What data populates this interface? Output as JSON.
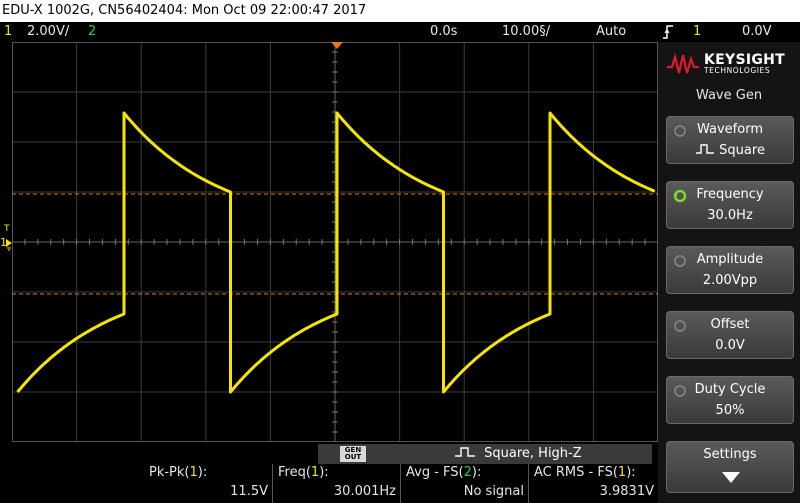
{
  "title_bar": {
    "text": "EDU-X 1002G, CN56402404: Mon Oct 09 22:00:47 2017"
  },
  "status_bar": {
    "ch1_number": "1",
    "ch1_scale": "2.00V/",
    "ch2_number": "2",
    "time_offset": "0.0s",
    "time_scale": "10.00§/",
    "trigger_mode": "Auto",
    "trigger_icon": "trigger-edge-icon",
    "trigger_source": "1",
    "trigger_level": "0.0V"
  },
  "screen": {
    "channel_marker": "1",
    "trigger_marker": "T",
    "trace_color": "#f5e600",
    "cursor_color": "#e6781e",
    "grid_color": "#3c3c3c"
  },
  "brand": {
    "name": "KEYSIGHT",
    "sub": "TECHNOLOGIES",
    "accent": "#e0182d"
  },
  "menu": {
    "title": "Wave Gen",
    "softkeys": [
      {
        "label": "Waveform",
        "value": "Square",
        "icon": "square-wave-icon"
      },
      {
        "label": "Frequency",
        "value": "30.0Hz",
        "active": true
      },
      {
        "label": "Amplitude",
        "value": "2.00Vpp"
      },
      {
        "label": "Offset",
        "value": "0.0V"
      },
      {
        "label": "Duty Cycle",
        "value": "50%"
      },
      {
        "label": "Settings",
        "icon": "arrow-down-icon"
      }
    ]
  },
  "wavegen": {
    "badge_top": "GEN",
    "badge_bottom": "OUT",
    "description": "Square, High-Z"
  },
  "measurements": [
    {
      "label_prefix": "Pk-Pk(",
      "channel": "1",
      "label_suffix": "):",
      "value": "11.5V"
    },
    {
      "label_prefix": "Freq(",
      "channel": "1",
      "label_suffix": "):",
      "value": "30.001Hz"
    },
    {
      "label_prefix": "Avg - FS(",
      "channel": "2",
      "label_suffix": "):",
      "value": "No signal"
    },
    {
      "label_prefix": "AC RMS - FS(",
      "channel": "1",
      "label_suffix": "):",
      "value": "3.9831V"
    }
  ]
}
